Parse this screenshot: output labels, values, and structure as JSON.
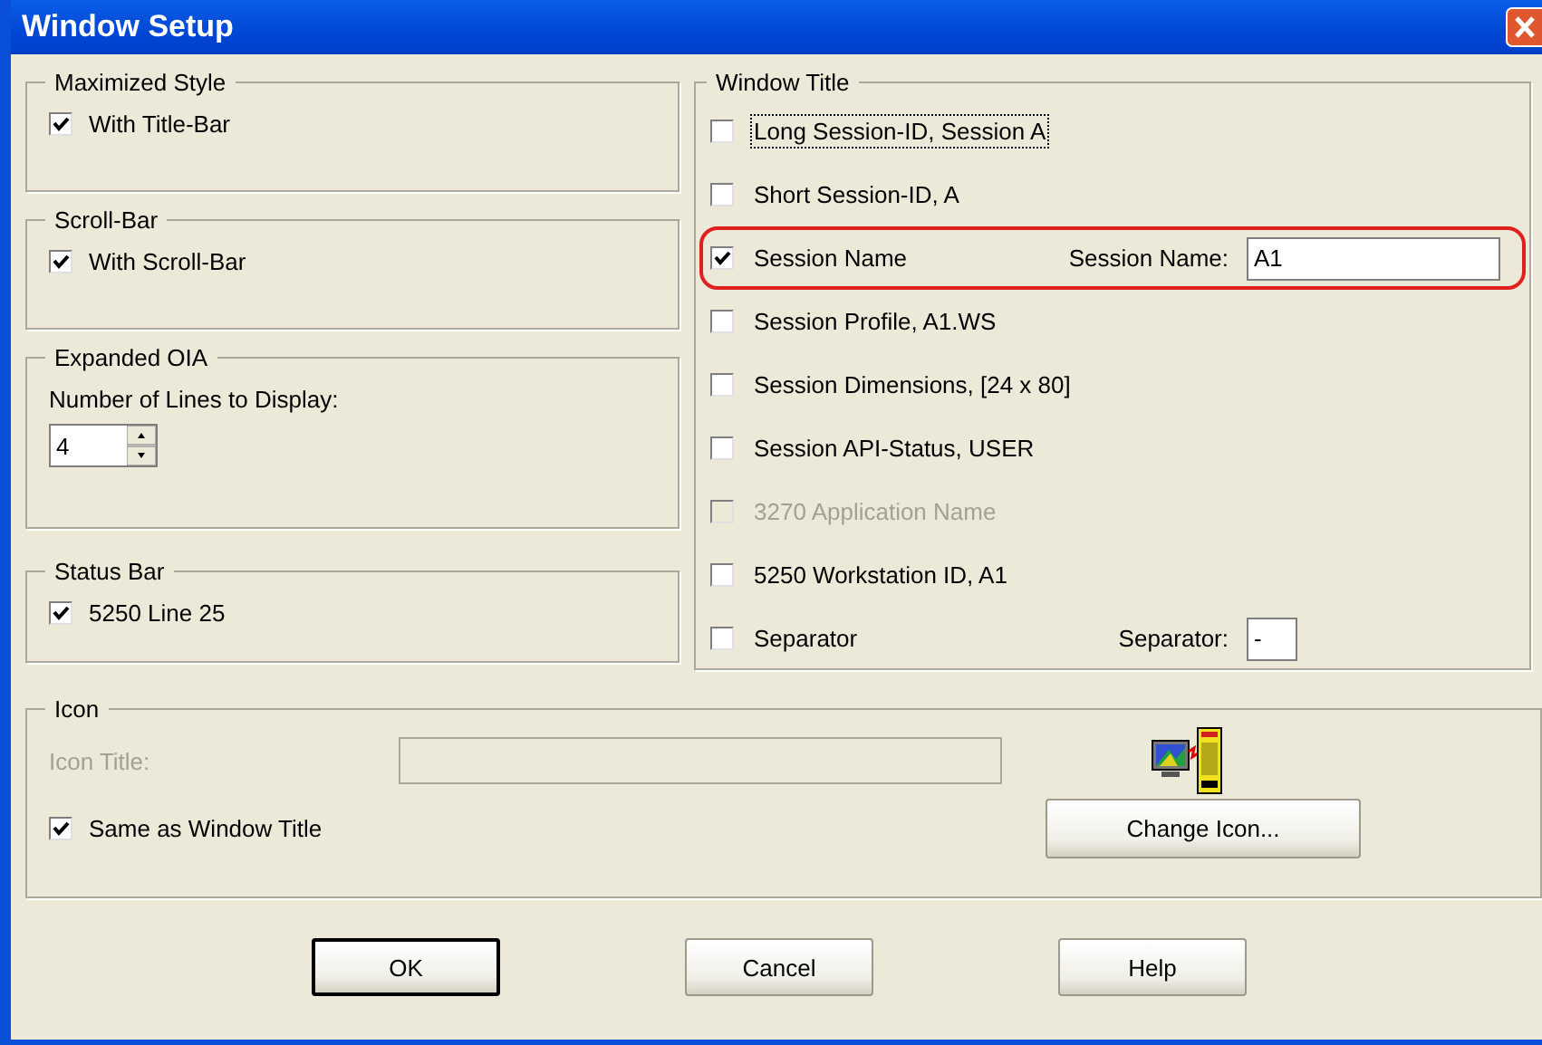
{
  "window": {
    "title": "Window Setup"
  },
  "left_groups": [
    {
      "title": "Maximized Style",
      "kind": "checkbox",
      "label": "With Title-Bar",
      "checked": true
    },
    {
      "title": "Scroll-Bar",
      "kind": "checkbox",
      "label": "With Scroll-Bar",
      "checked": true
    },
    {
      "title": "Expanded OIA",
      "kind": "spinner",
      "label": "Number of Lines to Display:",
      "value": "4"
    },
    {
      "title": "Status Bar",
      "kind": "checkbox",
      "label": "5250 Line 25",
      "checked": true
    }
  ],
  "window_title": {
    "title": "Window Title",
    "options": [
      {
        "label": "Long Session-ID, Session A",
        "checked": false,
        "disabled": false,
        "focused": true,
        "highlighted": false
      },
      {
        "label": "Short Session-ID, A",
        "checked": false,
        "disabled": false,
        "focused": false,
        "highlighted": false
      },
      {
        "label": "Session Name",
        "checked": true,
        "disabled": false,
        "focused": false,
        "highlighted": true,
        "field_label": "Session Name:",
        "field_value": "A1",
        "kind": "wide-field"
      },
      {
        "label": "Session Profile, A1.WS",
        "checked": false,
        "disabled": false,
        "focused": false,
        "highlighted": false
      },
      {
        "label": "Session Dimensions, [24 x 80]",
        "checked": false,
        "disabled": false,
        "focused": false,
        "highlighted": false
      },
      {
        "label": "Session API-Status, USER",
        "checked": false,
        "disabled": false,
        "focused": false,
        "highlighted": false
      },
      {
        "label": "3270 Application Name",
        "checked": false,
        "disabled": true,
        "focused": false,
        "highlighted": false
      },
      {
        "label": "5250 Workstation ID, A1",
        "checked": false,
        "disabled": false,
        "focused": false,
        "highlighted": false
      },
      {
        "label": "Separator",
        "checked": false,
        "disabled": false,
        "focused": false,
        "highlighted": false,
        "field_label": "Separator:",
        "field_value": "-",
        "kind": "narrow-field"
      }
    ]
  },
  "icon_group": {
    "title": "Icon",
    "icon_title_label": "Icon Title:",
    "icon_title_disabled": true,
    "same_as_label": "Same as Window Title",
    "same_as_checked": true,
    "change_button": "Change Icon..."
  },
  "buttons": [
    {
      "label": "OK",
      "default": true
    },
    {
      "label": "Cancel",
      "default": false
    },
    {
      "label": "Help",
      "default": false
    }
  ]
}
